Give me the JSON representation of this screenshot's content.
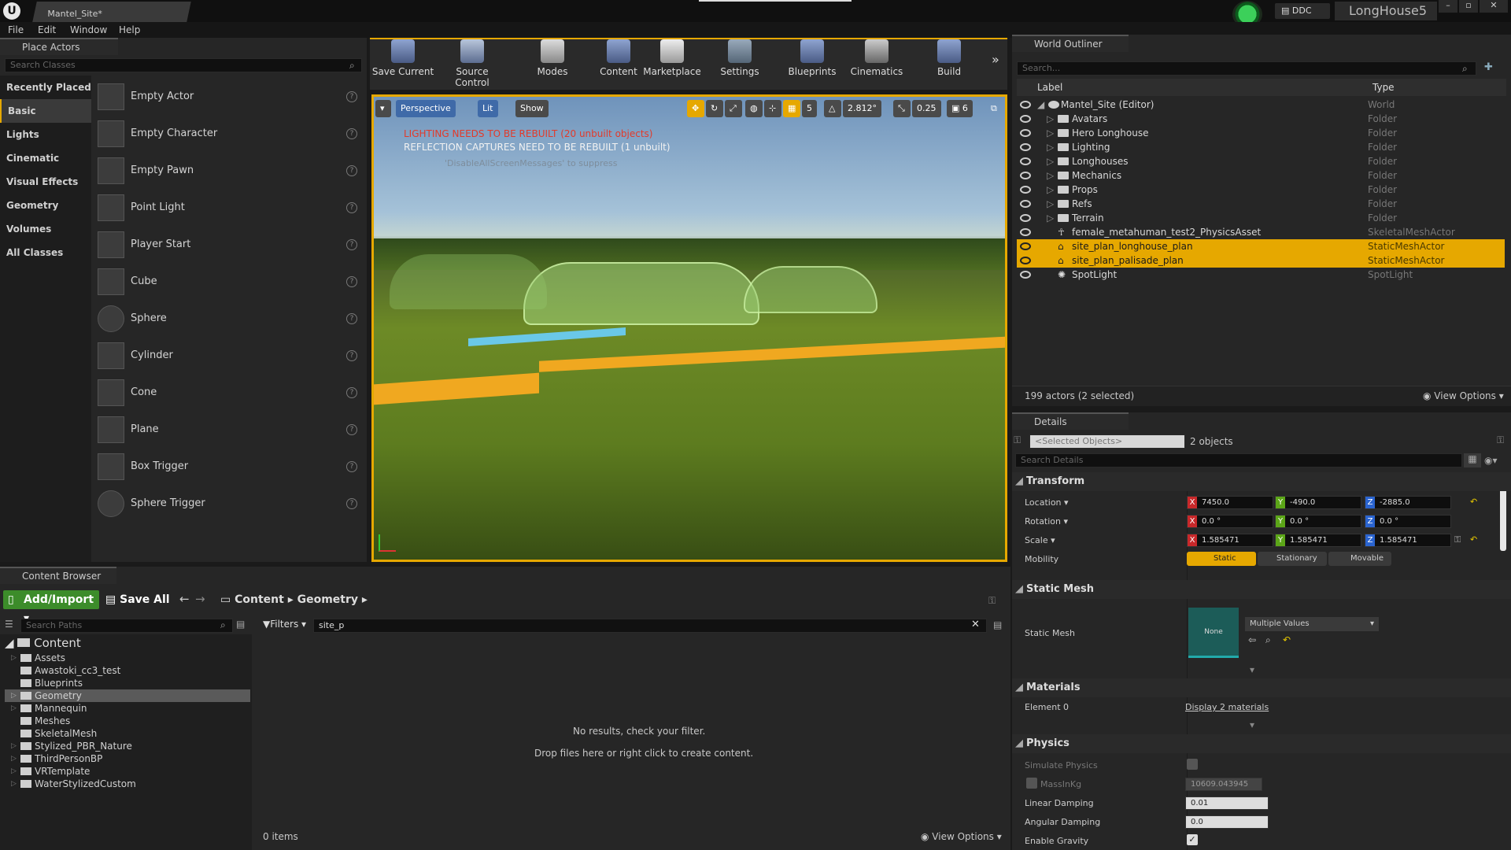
{
  "title_bar": {
    "doc_tab": "Mantel_Site*",
    "ddc": "DDC",
    "project": "LongHouse5"
  },
  "menu": [
    "File",
    "Edit",
    "Window",
    "Help"
  ],
  "place_actors": {
    "tab": "Place Actors",
    "search_placeholder": "Search Classes",
    "categories": [
      "Recently Placed",
      "Basic",
      "Lights",
      "Cinematic",
      "Visual Effects",
      "Geometry",
      "Volumes",
      "All Classes"
    ],
    "actors": [
      "Empty Actor",
      "Empty Character",
      "Empty Pawn",
      "Point Light",
      "Player Start",
      "Cube",
      "Sphere",
      "Cylinder",
      "Cone",
      "Plane",
      "Box Trigger",
      "Sphere Trigger"
    ]
  },
  "toolbar": [
    "Save Current",
    "Source Control",
    "Modes",
    "Content",
    "Marketplace",
    "Settings",
    "Blueprints",
    "Cinematics",
    "Build"
  ],
  "viewport": {
    "perspective": "Perspective",
    "lit": "Lit",
    "show": "Show",
    "grid_size": "5",
    "rotation_snap": "2.812°",
    "scale_snap": "0.25",
    "camera_speed": "6",
    "warning1": "LIGHTING NEEDS TO BE REBUILT (20 unbuilt objects)",
    "warning2": "REFLECTION CAPTURES NEED TO BE REBUILT (1 unbuilt)",
    "warning3": "'DisableAllScreenMessages' to suppress"
  },
  "world_outliner": {
    "tab": "World Outliner",
    "search_placeholder": "Search...",
    "col_label": "Label",
    "col_type": "Type",
    "rows": [
      {
        "label": "Mantel_Site (Editor)",
        "type": "World"
      },
      {
        "label": "Avatars",
        "type": "Folder"
      },
      {
        "label": "Hero Longhouse",
        "type": "Folder"
      },
      {
        "label": "Lighting",
        "type": "Folder"
      },
      {
        "label": "Longhouses",
        "type": "Folder"
      },
      {
        "label": "Mechanics",
        "type": "Folder"
      },
      {
        "label": "Props",
        "type": "Folder"
      },
      {
        "label": "Refs",
        "type": "Folder"
      },
      {
        "label": "Terrain",
        "type": "Folder"
      },
      {
        "label": "female_metahuman_test2_PhysicsAsset",
        "type": "SkeletalMeshActor"
      },
      {
        "label": "site_plan_longhouse_plan",
        "type": "StaticMeshActor"
      },
      {
        "label": "site_plan_palisade_plan",
        "type": "StaticMeshActor"
      },
      {
        "label": "SpotLight",
        "type": "SpotLight"
      }
    ],
    "status": "199 actors (2 selected)",
    "view_options": "View Options"
  },
  "details": {
    "tab": "Details",
    "selected_placeholder": "<Selected Objects>",
    "objects": "2 objects",
    "search_placeholder": "Search Details",
    "transform": "Transform",
    "location_label": "Location",
    "location": [
      "7450.0",
      "-490.0",
      "-2885.0"
    ],
    "rotation_label": "Rotation",
    "rotation": [
      "0.0 °",
      "0.0 °",
      "0.0 °"
    ],
    "scale_label": "Scale",
    "scale": [
      "1.585471",
      "1.585471",
      "1.585471"
    ],
    "mobility_label": "Mobility",
    "mobility": [
      "Static",
      "Stationary",
      "Movable"
    ],
    "static_mesh_head": "Static Mesh",
    "static_mesh_label": "Static Mesh",
    "mesh_thumb": "None",
    "mesh_value": "Multiple Values",
    "materials_head": "Materials",
    "element0": "Element 0",
    "display_materials": "Display 2 materials",
    "physics_head": "Physics",
    "simulate_physics": "Simulate Physics",
    "mass_label": "MassInKg",
    "mass_value": "10609.043945",
    "linear_damping_label": "Linear Damping",
    "linear_damping": "0.01",
    "angular_damping_label": "Angular Damping",
    "angular_damping": "0.0",
    "enable_gravity": "Enable Gravity"
  },
  "content_browser": {
    "tab": "Content Browser",
    "add_import": "Add/Import",
    "save_all": "Save All",
    "path": [
      "Content",
      "Geometry"
    ],
    "search_paths": "Search Paths",
    "filters": "Filters",
    "filter_text": "site_p",
    "tree_root": "Content",
    "folders": [
      "Assets",
      "Awastoki_cc3_test",
      "Blueprints",
      "Geometry",
      "Mannequin",
      "Meshes",
      "SkeletalMesh",
      "Stylized_PBR_Nature",
      "ThirdPersonBP",
      "VRTemplate",
      "WaterStylizedCustom"
    ],
    "empty1": "No results, check your filter.",
    "empty2": "Drop files here or right click to create content.",
    "items": "0 items",
    "view_options": "View Options"
  },
  "colors": {
    "accent": "#e6a800",
    "panel": "#262626",
    "warning": "#e23a2a",
    "add_green": "#3c8c2a"
  }
}
